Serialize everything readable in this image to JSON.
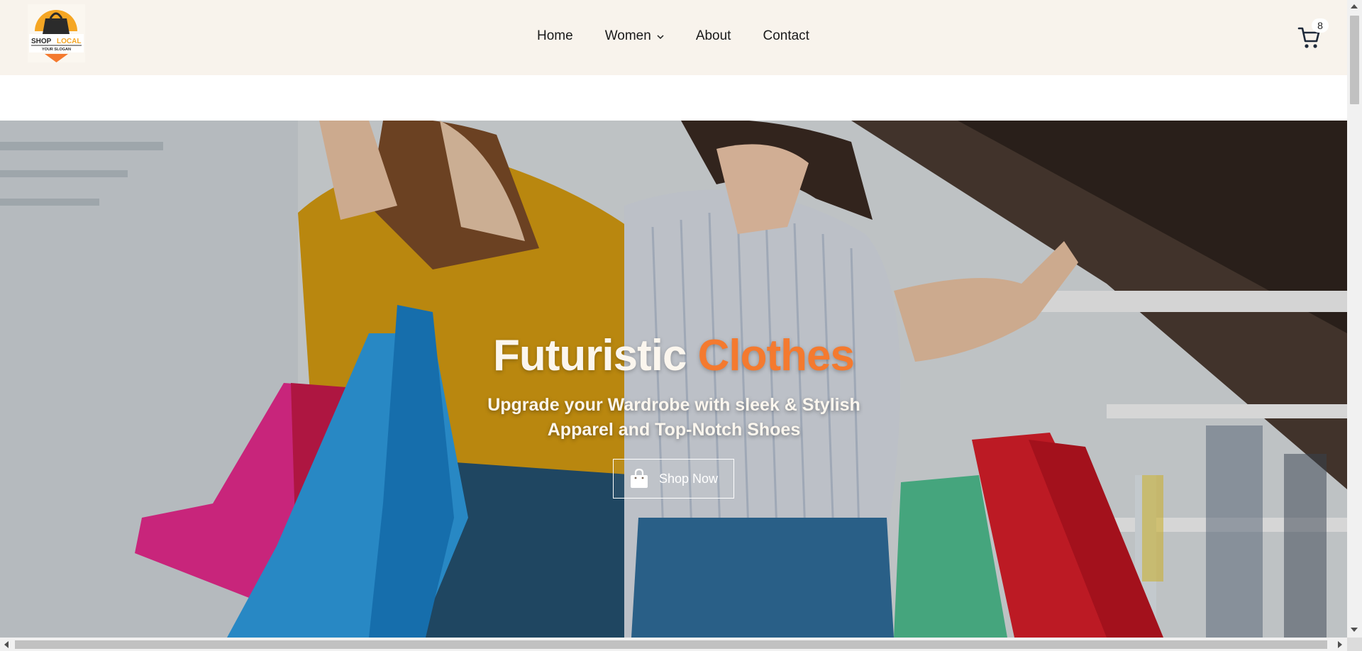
{
  "header": {
    "logo": {
      "brand_word1": "SHOP",
      "brand_word2": "LOCAL",
      "slogan": "YOUR SLOGAN",
      "icon": "shopping-bag-icon"
    },
    "nav": [
      {
        "label": "Home"
      },
      {
        "label": "Women",
        "has_dropdown": true
      },
      {
        "label": "About"
      },
      {
        "label": "Contact"
      }
    ],
    "cart": {
      "icon": "cart-icon",
      "count": "8"
    }
  },
  "hero": {
    "title_part1": "Futuristic",
    "title_part2": "Clothes",
    "subtitle": "Upgrade your Wardrobe with sleek & Stylish Apparel and Top-Notch Shoes",
    "cta": {
      "label": "Shop Now",
      "icon": "shopping-bag-icon"
    }
  },
  "colors": {
    "header_bg": "#f8f3ec",
    "accent": "#f47a2f",
    "hero_text": "#fbf6ee"
  }
}
